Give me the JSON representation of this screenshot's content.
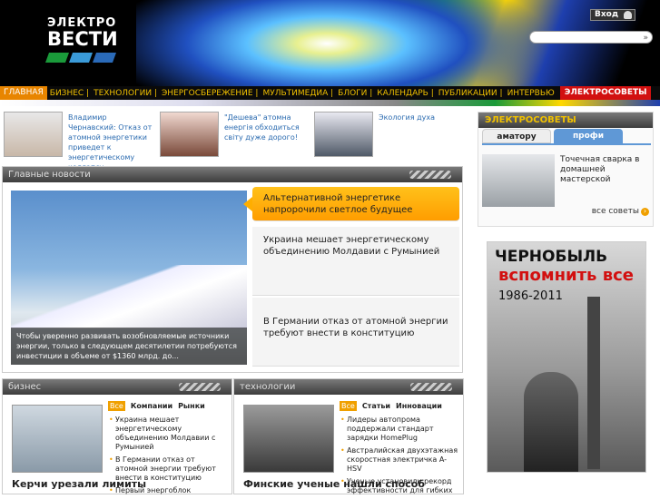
{
  "header": {
    "logo_line1": "ЭЛЕКТРО",
    "logo_line2": "ВЕСТИ",
    "logo_bar_colors": [
      "#1a9a3a",
      "#3a9ad8",
      "#2a6ab8"
    ],
    "login_label": "Вход",
    "search_placeholder": ""
  },
  "nav": {
    "items": [
      {
        "label": "ГЛАВНАЯ",
        "state": "active"
      },
      {
        "label": "БИЗНЕС |"
      },
      {
        "label": "ТЕХНОЛОГИИ |"
      },
      {
        "label": "ЭНЕРГОСБЕРЕЖЕНИЕ |"
      },
      {
        "label": "МУЛЬТИМЕДИА |"
      },
      {
        "label": "БЛОГИ |"
      },
      {
        "label": "КАЛЕНДАРЬ |"
      },
      {
        "label": "ПУБЛИКАЦИИ |"
      },
      {
        "label": "ИНТЕРВЬЮ"
      },
      {
        "label": "ЭЛЕКТРОСОВЕТЫ",
        "state": "highlight"
      }
    ],
    "accent_color": "#e88500",
    "highlight_color": "#d21010"
  },
  "people": [
    {
      "caption": "Владимир Чернавский: Отказ от атомной энергетики приведет к энергетическому коллапсу"
    },
    {
      "caption": "\"Дешева\" атомна енергія обходиться світу дуже дорого!"
    },
    {
      "caption": "Экология духа"
    }
  ],
  "main_news": {
    "header": "Главные новости",
    "hero_caption": "Чтобы уверенно развивать возобновляемые источники энергии, только в следующем десятилетии потребуются инвестиции в объеме от $1360 млрд. до...",
    "stories": [
      {
        "title": "Альтернативной энергетике напророчили светлое будущее",
        "active": true
      },
      {
        "title": "Украина мешает энергетическому объединению Молдавии с Румынией",
        "active": false
      },
      {
        "title": "В Германии отказ от атомной энергии требуют внести в конституцию",
        "active": false
      }
    ]
  },
  "business": {
    "header": "бизнес",
    "all_label": "Все",
    "tags": [
      "Компании",
      "Рынки"
    ],
    "thumb_title": "Керчи урезали лимиты",
    "items": [
      "Украина мешает энергетическому объединению Молдавии с Румынией",
      "В Германии отказ от атомной энергии требуют внести в конституцию",
      "Первый энергоблок"
    ]
  },
  "technology": {
    "header": "технологии",
    "all_label": "Все",
    "tags": [
      "Статьи",
      "Инновации"
    ],
    "thumb_title": "Финские ученые нашли способ",
    "items": [
      "Лидеры автопрома поддержали стандарт зарядки HomePlug",
      "Австралийская двухэтажная скоростная электричка A-HSV",
      "Ученые установили рекорд эффективности для гибких"
    ]
  },
  "advice": {
    "header": "ЭЛЕКТРОСОВЕТЫ",
    "tabs": [
      "аматору",
      "профи"
    ],
    "item_title": "Точечная сварка в домашней мастерской",
    "all_label": "все советы"
  },
  "banner": {
    "line1": "ЧЕРНОБЫЛЬ",
    "line2": "вспомнить все",
    "line3": "1986-2011"
  }
}
